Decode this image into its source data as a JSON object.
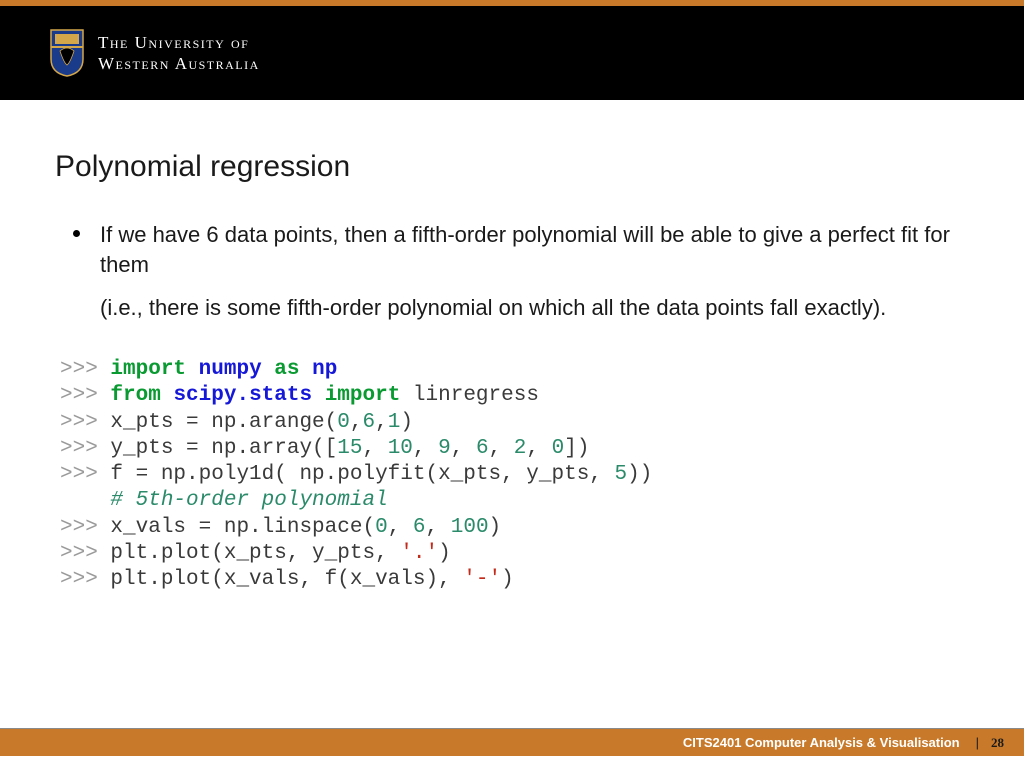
{
  "header": {
    "uni_line1": "The University of",
    "uni_line2": "Western Australia"
  },
  "title": "Polynomial regression",
  "bullet": {
    "p1": "If we have 6 data points, then a fifth-order polynomial will be able to give a perfect fit for them",
    "p2": "(i.e., there is some fifth-order polynomial on which all the data points fall exactly)."
  },
  "code": {
    "prompt": ">>> ",
    "kw_import": "import",
    "kw_from": "from",
    "kw_as": "as",
    "mod_numpy": "numpy",
    "mod_np": "np",
    "mod_scipy": "scipy.stats",
    "fn_linregress": " linregress",
    "l3a": "x_pts = np.arange(",
    "l3_n0": "0",
    "l3_c1": ",",
    "l3_n6": "6",
    "l3_c2": ",",
    "l3_n1": "1",
    "l3b": ")",
    "l4a": "y_pts = np.array([",
    "l4_n15": "15",
    "l4_c1": ", ",
    "l4_n10": "10",
    "l4_c2": ", ",
    "l4_n9": "9",
    "l4_c3": ", ",
    "l4_n6": "6",
    "l4_c4": ", ",
    "l4_n2": "2",
    "l4_c5": ", ",
    "l4_n0": "0",
    "l4b": "])",
    "l5a": "f = np.poly1d( np.polyfit(x_pts, y_pts, ",
    "l5_n5": "5",
    "l5b": "))",
    "comment_indent": "    ",
    "comment": "# 5th-order polynomial",
    "l7a": "x_vals = np.linspace(",
    "l7_n0": "0",
    "l7_c1": ", ",
    "l7_n6": "6",
    "l7_c2": ", ",
    "l7_n100": "100",
    "l7b": ")",
    "l8a": "plt.plot(x_pts, y_pts, ",
    "l8_str": "'.'",
    "l8b": ")",
    "l9a": "plt.plot(x_vals, f(x_vals), ",
    "l9_str": "'-'",
    "l9b": ")"
  },
  "footer": {
    "course": "CITS2401 Computer Analysis & Visualisation",
    "divider": "|",
    "page": "28"
  }
}
